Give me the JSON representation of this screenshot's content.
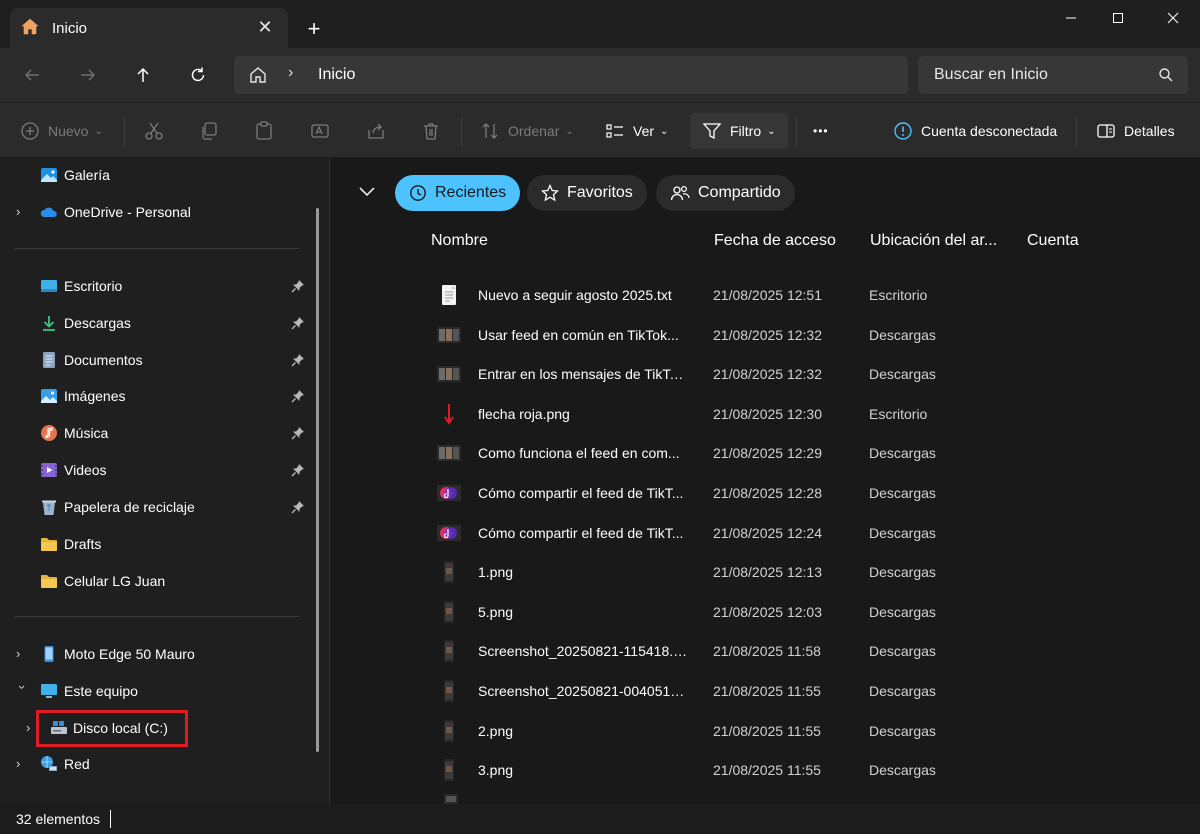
{
  "tab": {
    "title": "Inicio",
    "close": "✕",
    "new_tab": "+"
  },
  "address": {
    "location": "Inicio",
    "chevron": "›"
  },
  "search": {
    "placeholder": "Buscar en Inicio"
  },
  "toolbar": {
    "new_label": "Nuevo",
    "sort_label": "Ordenar",
    "view_label": "Ver",
    "filter_label": "Filtro",
    "more_label": "•••",
    "account_label": "Cuenta desconectada",
    "details_label": "Detalles"
  },
  "sidebar": {
    "items": [
      {
        "label": "Galería",
        "icon": "gallery-icon"
      },
      {
        "label": "OneDrive - Personal",
        "icon": "cloud-icon"
      },
      {
        "label": "Escritorio",
        "icon": "desktop-folder-icon",
        "pinned": true
      },
      {
        "label": "Descargas",
        "icon": "download-icon",
        "pinned": true
      },
      {
        "label": "Documentos",
        "icon": "documents-icon",
        "pinned": true
      },
      {
        "label": "Imágenes",
        "icon": "pictures-icon",
        "pinned": true
      },
      {
        "label": "Música",
        "icon": "music-icon",
        "pinned": true
      },
      {
        "label": "Videos",
        "icon": "videos-icon",
        "pinned": true
      },
      {
        "label": "Papelera de reciclaje",
        "icon": "recycle-bin-icon",
        "pinned": true
      },
      {
        "label": "Drafts",
        "icon": "folder-icon"
      },
      {
        "label": "Celular LG Juan",
        "icon": "folder-icon"
      },
      {
        "label": "Moto Edge 50 Mauro",
        "icon": "phone-icon"
      },
      {
        "label": "Este equipo",
        "icon": "computer-icon"
      },
      {
        "label": "Disco local (C:)",
        "icon": "drive-icon"
      },
      {
        "label": "Red",
        "icon": "network-icon"
      }
    ]
  },
  "filters": {
    "recent": "Recientes",
    "favorites": "Favoritos",
    "shared": "Compartido"
  },
  "columns": {
    "name": "Nombre",
    "date": "Fecha de acceso",
    "location": "Ubicación del ar...",
    "account": "Cuenta"
  },
  "files": [
    {
      "name": "Nuevo a seguir agosto 2025.txt",
      "date": "21/08/2025 12:51",
      "location": "Escritorio",
      "icon": "text-file-icon"
    },
    {
      "name": "Usar feed en común en TikTok...",
      "date": "21/08/2025 12:32",
      "location": "Descargas",
      "icon": "image-thumbnail-icon"
    },
    {
      "name": "Entrar en los mensajes de TikTo...",
      "date": "21/08/2025 12:32",
      "location": "Descargas",
      "icon": "image-thumbnail-icon"
    },
    {
      "name": "flecha roja.png",
      "date": "21/08/2025 12:30",
      "location": "Escritorio",
      "icon": "red-arrow-icon"
    },
    {
      "name": "Como funciona el feed en com...",
      "date": "21/08/2025 12:29",
      "location": "Descargas",
      "icon": "image-thumbnail-icon"
    },
    {
      "name": "Cómo compartir el feed de TikT...",
      "date": "21/08/2025 12:28",
      "location": "Descargas",
      "icon": "tiktok-thumbnail-icon"
    },
    {
      "name": "Cómo compartir el feed de TikT...",
      "date": "21/08/2025 12:24",
      "location": "Descargas",
      "icon": "tiktok-thumbnail-icon"
    },
    {
      "name": "1.png",
      "date": "21/08/2025 12:13",
      "location": "Descargas",
      "icon": "phone-screenshot-icon"
    },
    {
      "name": "5.png",
      "date": "21/08/2025 12:03",
      "location": "Descargas",
      "icon": "phone-screenshot-icon"
    },
    {
      "name": "Screenshot_20250821-115418.Ti...",
      "date": "21/08/2025 11:58",
      "location": "Descargas",
      "icon": "phone-screenshot-icon"
    },
    {
      "name": "Screenshot_20250821-004051.Ti...",
      "date": "21/08/2025 11:55",
      "location": "Descargas",
      "icon": "phone-screenshot-icon"
    },
    {
      "name": "2.png",
      "date": "21/08/2025 11:55",
      "location": "Descargas",
      "icon": "phone-screenshot-icon"
    },
    {
      "name": "3.png",
      "date": "21/08/2025 11:55",
      "location": "Descargas",
      "icon": "phone-screenshot-icon"
    }
  ],
  "status": {
    "count": "32 elementos"
  },
  "colors": {
    "accent": "#4cc2ff",
    "highlight_box": "#e01b24"
  }
}
